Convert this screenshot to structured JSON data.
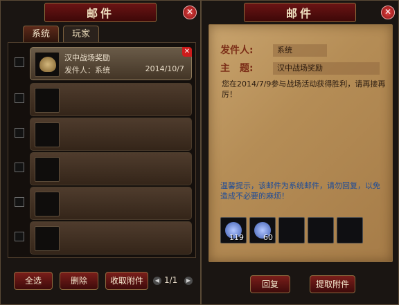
{
  "left_panel": {
    "title": "邮件",
    "tabs": [
      {
        "label": "系统",
        "active": true
      },
      {
        "label": "玩家",
        "active": false
      }
    ],
    "mails": [
      {
        "subject": "汉中战场奖励",
        "sender_line": "发件人：系统",
        "date": "2014/10/7",
        "has_attachment_icon": "coin-bag-icon",
        "selected": true
      },
      {
        "subject": "",
        "sender_line": "",
        "date": "",
        "has_attachment_icon": "",
        "selected": false
      },
      {
        "subject": "",
        "sender_line": "",
        "date": "",
        "has_attachment_icon": "",
        "selected": false
      },
      {
        "subject": "",
        "sender_line": "",
        "date": "",
        "has_attachment_icon": "",
        "selected": false
      },
      {
        "subject": "",
        "sender_line": "",
        "date": "",
        "has_attachment_icon": "",
        "selected": false
      },
      {
        "subject": "",
        "sender_line": "",
        "date": "",
        "has_attachment_icon": "",
        "selected": false
      }
    ],
    "buttons": {
      "select_all": "全选",
      "delete": "删除",
      "collect": "收取附件"
    },
    "pagination": "1/1"
  },
  "right_panel": {
    "title": "邮件",
    "sender_label": "发件人:",
    "sender_value": "系统",
    "subject_label": "主　题:",
    "subject_value": "汉中战场奖励",
    "body": "您在2014/7/9参与战场活动获得胜利，请再接再厉！",
    "notice": "温馨提示，该邮件为系统邮件，请勿回复，以免造成不必要的麻烦！",
    "attachments": [
      {
        "icon": "blue-orb-icon",
        "qty": "119"
      },
      {
        "icon": "blue-orb-icon",
        "qty": "60"
      },
      {
        "icon": "",
        "qty": ""
      },
      {
        "icon": "",
        "qty": ""
      },
      {
        "icon": "",
        "qty": ""
      }
    ],
    "buttons": {
      "reply": "回复",
      "collect": "提取附件"
    }
  },
  "colors": {
    "title_red": "#6b1414",
    "parchment": "#b58d56",
    "notice_blue": "#1e4c98"
  }
}
